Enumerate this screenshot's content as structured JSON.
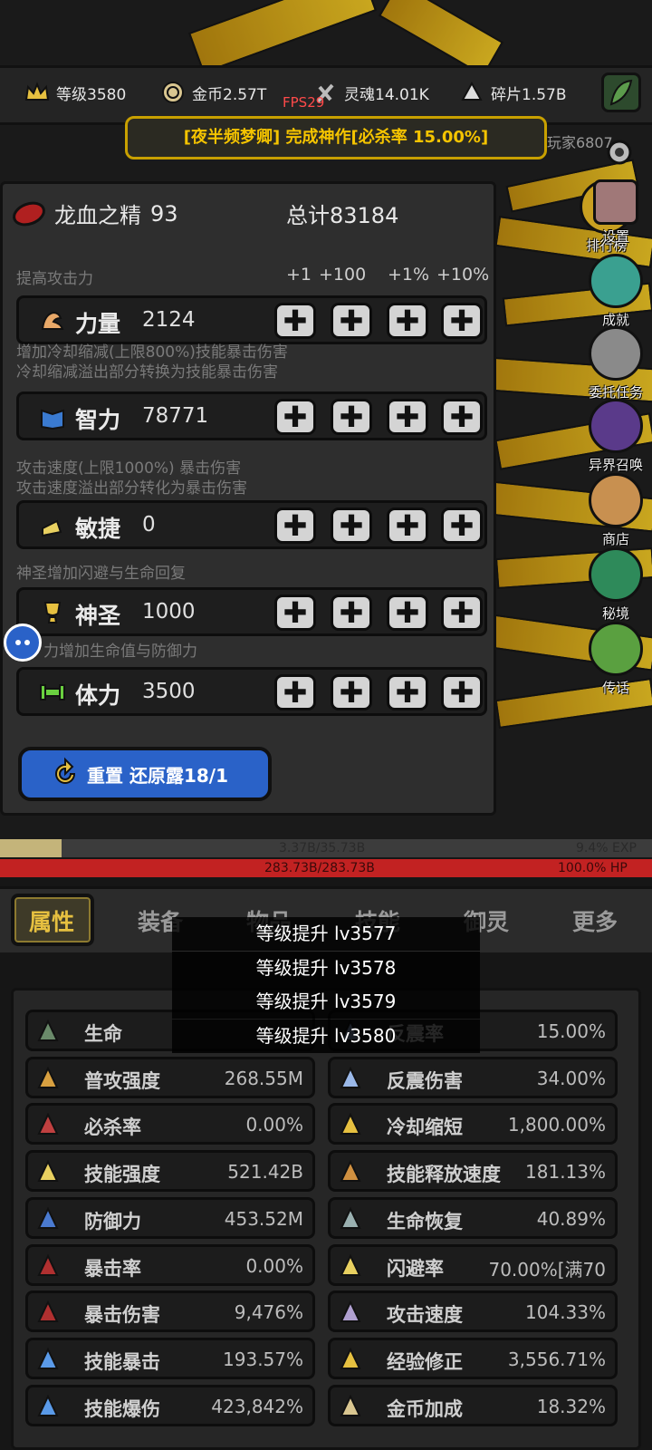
{
  "resources": {
    "level": "等级3580",
    "gold": "金币2.57T",
    "soul": "灵魂14.01K",
    "shard": "碎片1.57B"
  },
  "fps": "FPS29",
  "notice": "[夜半频梦卿] 完成神作[必杀率 15.00%]",
  "player_tag": "玩家6807",
  "side_menu": [
    "排行榜",
    "设置",
    "成就",
    "委托任务",
    "异界召唤",
    "商店",
    "秘境",
    "传话"
  ],
  "essence": {
    "name": "龙血之精",
    "count": "93",
    "total": "总计83184"
  },
  "attr_headers": [
    "+1",
    "+100",
    "+1%",
    "+10%"
  ],
  "hints": {
    "strength": "提高攻击力",
    "intellect": [
      "增加冷却缩减(上限800%)技能暴击伤害",
      "冷却缩减溢出部分转换为技能暴击伤害"
    ],
    "agility": [
      "攻击速度(上限1000%) 暴击伤害",
      "攻击速度溢出部分转化为暴击伤害"
    ],
    "holy": "神圣增加闪避与生命回复",
    "stamina": "力增加生命值与防御力"
  },
  "attributes": [
    {
      "name": "力量",
      "value": "2124",
      "icon": "arm-icon"
    },
    {
      "name": "智力",
      "value": "78771",
      "icon": "book-icon"
    },
    {
      "name": "敏捷",
      "value": "0",
      "icon": "boot-icon"
    },
    {
      "name": "神圣",
      "value": "1000",
      "icon": "trophy-icon"
    },
    {
      "name": "体力",
      "value": "3500",
      "icon": "bone-icon"
    }
  ],
  "plus_symbol": "✚",
  "reset_button": "重置 还原露18/1",
  "exp": {
    "text": "3.37B/35.73B",
    "percent": "9.4% EXP",
    "fill": 0.094
  },
  "hp": {
    "text": "283.73B/283.73B",
    "percent": "100.0%  HP"
  },
  "tabs": [
    "属性",
    "装备",
    "物品",
    "技能",
    "御灵",
    "更多"
  ],
  "level_toasts": [
    "等级提升 lv3577",
    "等级提升 lv3578",
    "等级提升 lv3579",
    "等级提升 lv3580"
  ],
  "stats": [
    [
      {
        "name": "生命",
        "value": ""
      },
      {
        "name": "反震率",
        "value": "15.00%"
      }
    ],
    [
      {
        "name": "普攻强度",
        "value": "268.55M"
      },
      {
        "name": "反震伤害",
        "value": "34.00%"
      }
    ],
    [
      {
        "name": "必杀率",
        "value": "0.00%"
      },
      {
        "name": "冷却缩短",
        "value": "1,800.00%"
      }
    ],
    [
      {
        "name": "技能强度",
        "value": "521.42B"
      },
      {
        "name": "技能释放速度",
        "value": "181.13%"
      }
    ],
    [
      {
        "name": "防御力",
        "value": "453.52M"
      },
      {
        "name": "生命恢复",
        "value": "40.89%"
      }
    ],
    [
      {
        "name": "暴击率",
        "value": "0.00%"
      },
      {
        "name": "闪避率",
        "value": "70.00%[满70"
      }
    ],
    [
      {
        "name": "暴击伤害",
        "value": "9,476%"
      },
      {
        "name": "攻击速度",
        "value": "104.33%"
      }
    ],
    [
      {
        "name": "技能暴击",
        "value": "193.57%"
      },
      {
        "name": "经验修正",
        "value": "3,556.71%"
      }
    ],
    [
      {
        "name": "技能爆伤",
        "value": "423,842%"
      },
      {
        "name": "金币加成",
        "value": "18.32%"
      }
    ]
  ],
  "colors": {
    "gold": "#e6c040",
    "hp": "#c22222",
    "exp": "#c4b47a",
    "reset": "#2a62c8"
  }
}
